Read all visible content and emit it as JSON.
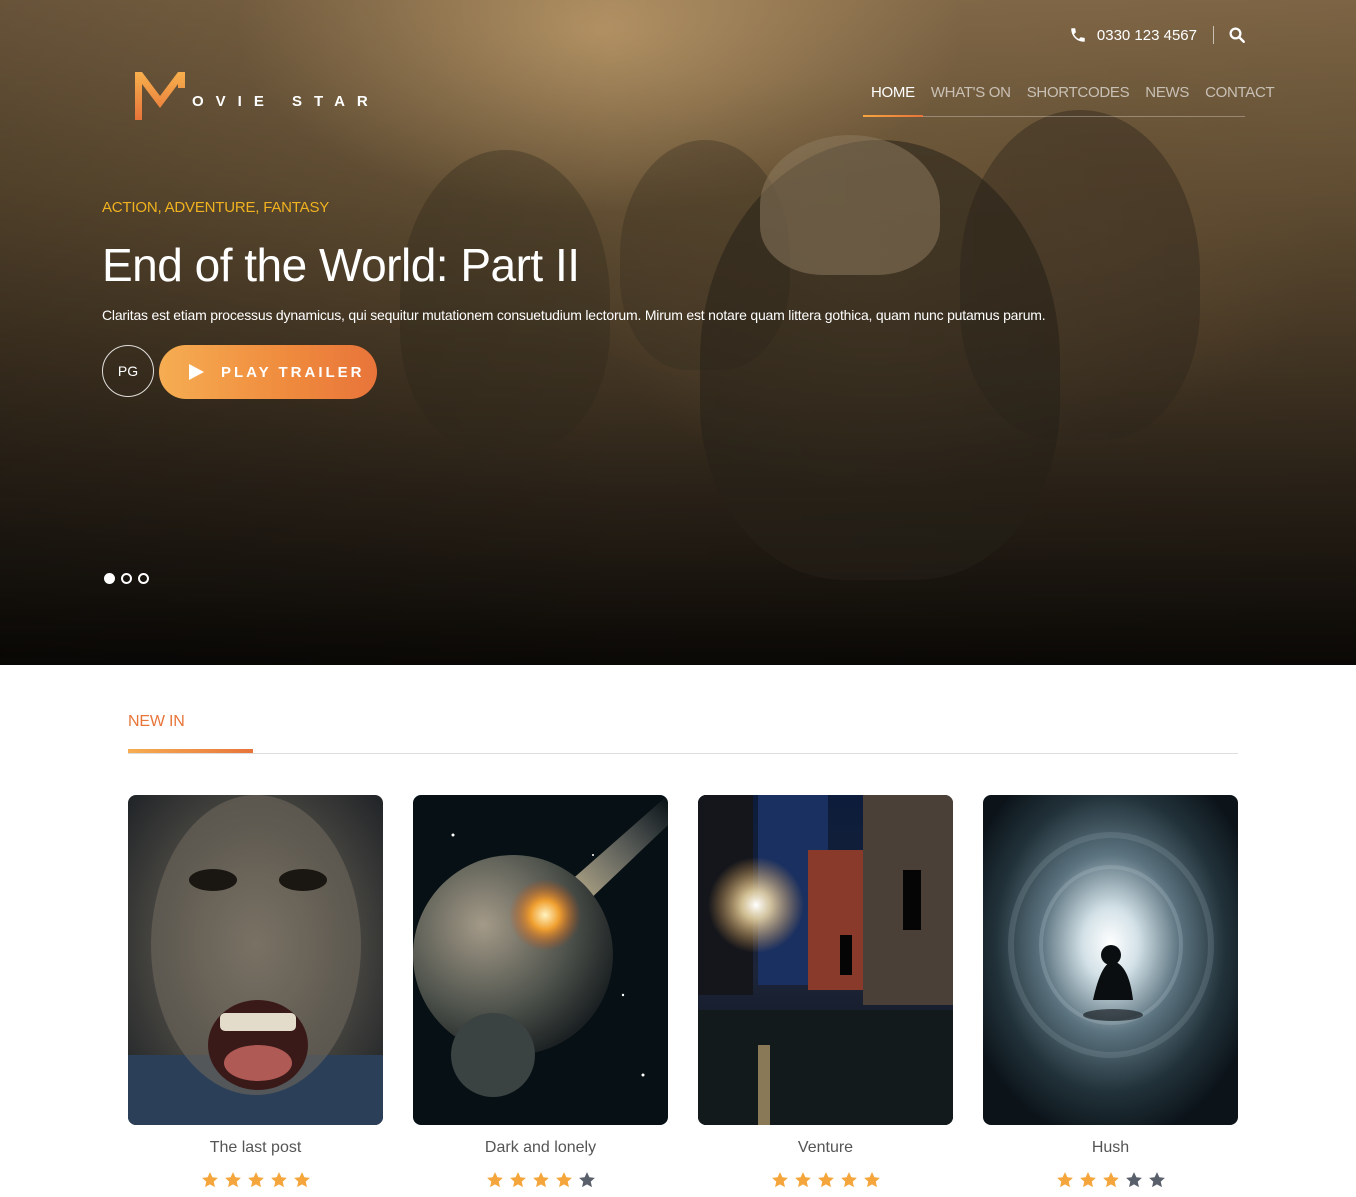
{
  "header": {
    "phone": "0330 123 4567",
    "logo_text": "OVIE STAR",
    "nav": [
      {
        "label": "HOME",
        "active": true
      },
      {
        "label": "WHAT'S ON",
        "active": false
      },
      {
        "label": "SHORTCODES",
        "active": false
      },
      {
        "label": "NEWS",
        "active": false
      },
      {
        "label": "CONTACT",
        "active": false
      }
    ]
  },
  "hero": {
    "genres": "ACTION, ADVENTURE, FANTASY",
    "title": "End of the World: Part II",
    "description": "Claritas est etiam processus dynamicus, qui sequitur mutationem consuetudium lectorum. Mirum est notare quam littera gothica, quam nunc putamus parum.",
    "rating": "PG",
    "play_label": "PLAY TRAILER",
    "slides": 3,
    "active_slide": 1
  },
  "new_in": {
    "title": "NEW IN",
    "movies": [
      {
        "title": "The last post",
        "rating": 5
      },
      {
        "title": "Dark and lonely",
        "rating": 4
      },
      {
        "title": "Venture",
        "rating": 5
      },
      {
        "title": "Hush",
        "rating": 3
      }
    ]
  },
  "colors": {
    "accent": "#e8753a",
    "accent_light": "#f6ad52",
    "genre": "#f1b21f",
    "star_on": "#f4a63c",
    "star_off": "#59606b"
  }
}
